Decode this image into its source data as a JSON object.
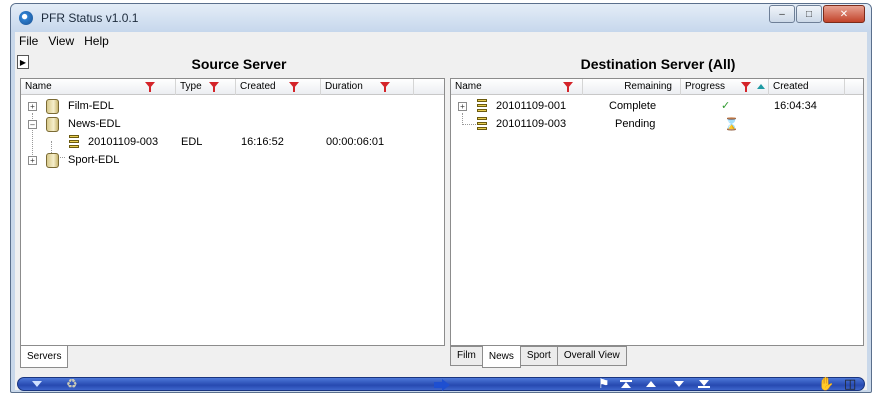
{
  "window": {
    "title": "PFR Status v1.0.1"
  },
  "menu": [
    "File",
    "View",
    "Help"
  ],
  "source": {
    "header": "Source Server",
    "columns": [
      "Name",
      "Type",
      "Created",
      "Duration"
    ],
    "tree": [
      {
        "name": "Film-EDL",
        "expanded": false
      },
      {
        "name": "News-EDL",
        "expanded": true,
        "children": [
          {
            "name": "20101109-003",
            "type": "EDL",
            "created": "16:16:52",
            "duration": "00:00:06:01"
          }
        ]
      },
      {
        "name": "Sport-EDL",
        "expanded": false
      }
    ],
    "tabs": [
      "Servers"
    ]
  },
  "destination": {
    "header": "Destination Server (All)",
    "columns": [
      "Name",
      "Remaining",
      "Progress",
      "Created"
    ],
    "rows": [
      {
        "name": "20101109-001",
        "remaining": "Complete",
        "progress_icon": "checkmark-icon",
        "created": "16:04:34",
        "expandable": true
      },
      {
        "name": "20101109-003",
        "remaining": "Pending",
        "progress_icon": "hourglass-icon",
        "created": "",
        "expandable": false
      }
    ],
    "tabs": [
      "Film",
      "News",
      "Sport",
      "Overall View"
    ],
    "active_tab": "News"
  },
  "toolbar_icons": [
    "dropdown-icon",
    "trash-icon",
    "transfer-arrow-icon",
    "finish-flag-icon",
    "move-top-icon",
    "move-up-icon",
    "move-down-icon",
    "move-bottom-icon",
    "hand-icon",
    "database-icon"
  ]
}
